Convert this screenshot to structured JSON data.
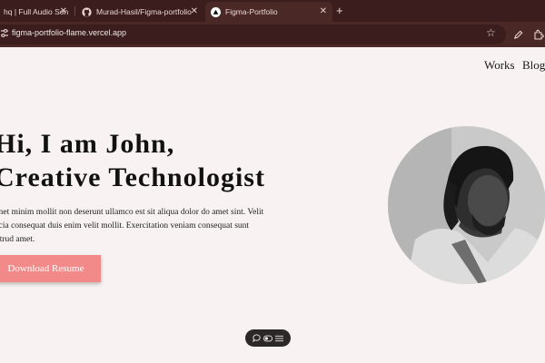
{
  "browser": {
    "tabs": [
      {
        "title": "hq | Full Audio Son",
        "favicon": "audio-favicon"
      },
      {
        "title": "Murad-Hasil/Figma-portfolio",
        "favicon": "github-icon"
      },
      {
        "title": "Figma-Portfolio",
        "favicon": "vercel-icon",
        "active": true
      }
    ],
    "url": "figma-portfolio-flame.vercel.app"
  },
  "nav": {
    "works": "Works",
    "blog": "Blog"
  },
  "hero": {
    "title_line1": "Hi, I am John,",
    "title_line2": "Creative Technologist",
    "body_line1": "met minim mollit non deserunt ullamco est sit aliqua dolor do amet sint. Velit",
    "body_line2": "icia consequat duis enim velit mollit. Exercitation veniam consequat sunt",
    "body_line3": "strud amet.",
    "button_label": "Download Resume"
  },
  "colors": {
    "button": "#f28a8a",
    "page_bg": "#f8f3f2",
    "tabbar": "#3a1d1c"
  },
  "floating_toolbar": {
    "icons": [
      "comment-icon",
      "toggle-icon",
      "menu-icon"
    ]
  }
}
